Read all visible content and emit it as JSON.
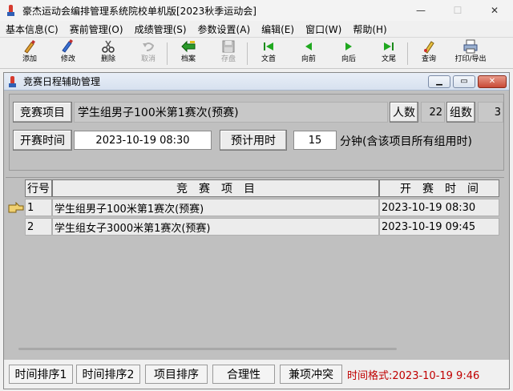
{
  "app": {
    "title": "豪杰运动会编排管理系统院校单机版[2023秋季运动会]"
  },
  "window_controls": {
    "minimize": "—",
    "maximize": "☐",
    "close": "✕"
  },
  "menu": [
    "基本信息(C)",
    "赛前管理(O)",
    "成绩管理(S)",
    "参数设置(A)",
    "编辑(E)",
    "窗口(W)",
    "帮助(H)"
  ],
  "toolbar": {
    "add": "添加",
    "edit": "修改",
    "delete": "删除",
    "cancel": "取消",
    "archive": "档案",
    "save": "存盘",
    "first": "文首",
    "prev": "向前",
    "next": "向后",
    "last": "文尾",
    "query": "查询",
    "print": "打印/导出"
  },
  "child": {
    "title": "竞赛日程辅助管理",
    "event_button": "竞赛项目",
    "event_value": "学生组男子100米第1赛次(预赛)",
    "people_button": "人数",
    "people_value": "22",
    "groups_button": "组数",
    "groups_value": "3",
    "start_button": "开赛时间",
    "start_value": "2023-10-19 08:30",
    "duration_button": "预计用时",
    "duration_value": "15",
    "duration_unit": "分钟(含该项目所有组用时)"
  },
  "grid": {
    "headers": {
      "row": "行号",
      "event": "竞　赛　项　目",
      "time": "开　赛　时　间"
    },
    "rows": [
      {
        "no": "1",
        "event": "学生组男子100米第1赛次(预赛)",
        "time": "2023-10-19 08:30"
      },
      {
        "no": "2",
        "event": "学生组女子3000米第1赛次(预赛)",
        "time": "2023-10-19 09:45"
      }
    ]
  },
  "bottom": {
    "sort_time1": "时间排序1",
    "sort_time2": "时间排序2",
    "sort_event": "项目排序",
    "validity": "合理性",
    "conflict": "兼项冲突",
    "time_format": "时间格式:2023-10-19 9:46"
  },
  "colors": {
    "time_format": "#c00000"
  }
}
